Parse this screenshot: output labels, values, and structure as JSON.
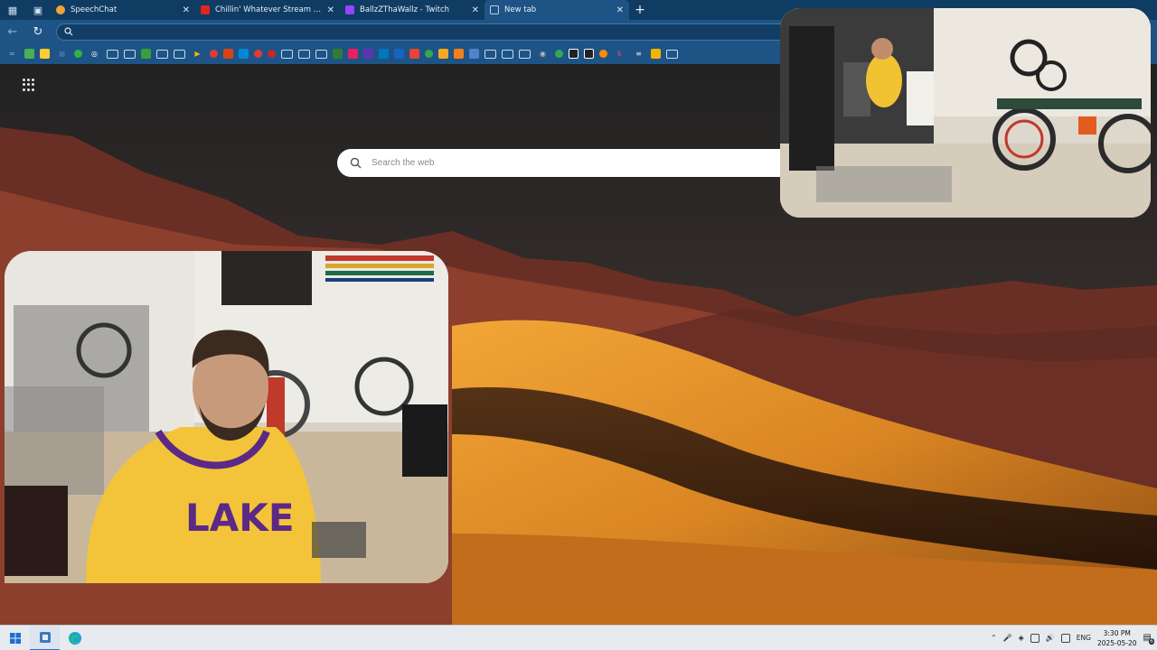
{
  "browser": {
    "tabs": [
      {
        "title": "SpeechChat",
        "favicon_color": "#f0a33a"
      },
      {
        "title": "Chillin' Whatever Stream - Fu",
        "favicon_color": "#e1261c"
      },
      {
        "title": "BallzZThaWallz - Twitch",
        "favicon_color": "#9146ff"
      },
      {
        "title": "New tab",
        "favicon_color": "#b9cfe2"
      }
    ],
    "active_tab_index": 3,
    "address_value": ""
  },
  "newtab": {
    "search_placeholder": "Search the web"
  },
  "taskbar": {
    "language": "ENG",
    "time": "3:30 PM",
    "date": "2025-05-20",
    "notification_count": "6"
  },
  "colors": {
    "tab_strip": "#0f3c63",
    "toolbar": "#1e5485",
    "taskbar": "#e7eaee"
  }
}
